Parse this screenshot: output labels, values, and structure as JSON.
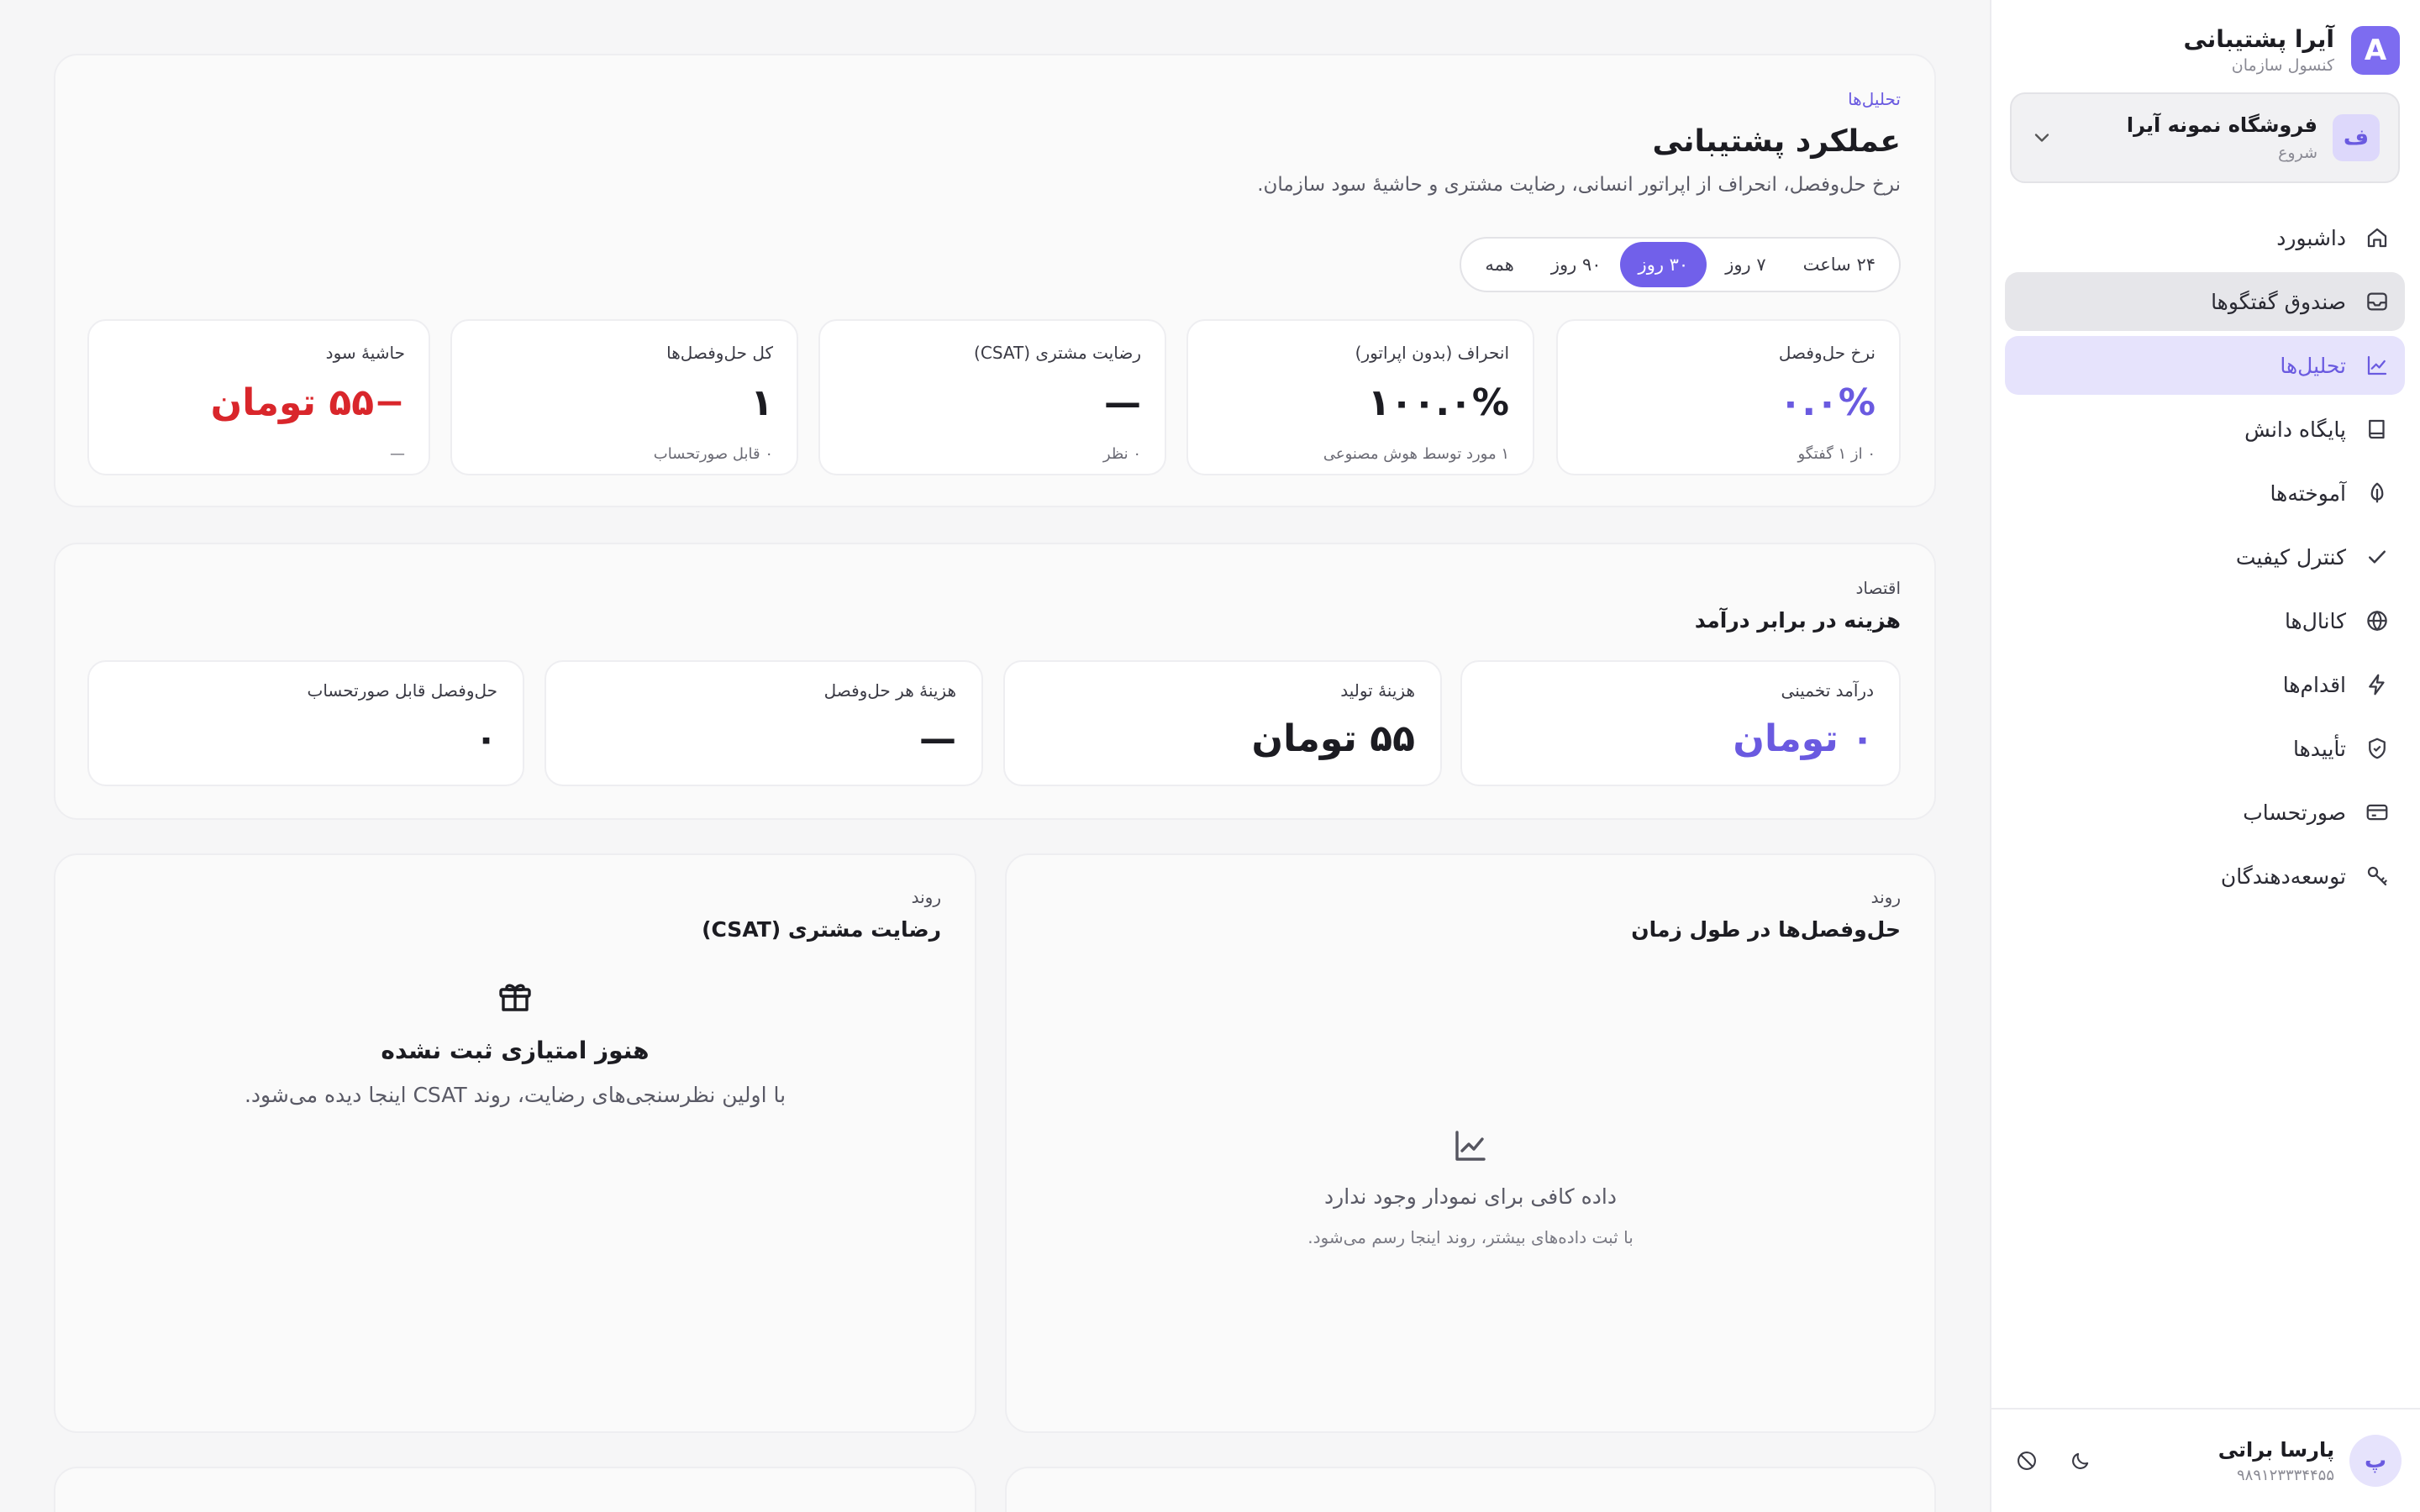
{
  "sidebar": {
    "brand": {
      "logo_letter": "A",
      "title": "آیرا پشتیبانی",
      "subtitle": "کنسول سازمان"
    },
    "org": {
      "avatar_letter": "ف",
      "name": "فروشگاه نمونه آیرا",
      "plan": "شروع"
    },
    "nav": [
      {
        "label": "داشبورد",
        "icon": "home-icon"
      },
      {
        "label": "صندوق گفتگوها",
        "icon": "inbox-icon"
      },
      {
        "label": "تحلیل‌ها",
        "icon": "chart-icon"
      },
      {
        "label": "پایگاه دانش",
        "icon": "book-icon"
      },
      {
        "label": "آموخته‌ها",
        "icon": "leaf-icon"
      },
      {
        "label": "کنترل کیفیت",
        "icon": "check-icon"
      },
      {
        "label": "کانال‌ها",
        "icon": "globe-icon"
      },
      {
        "label": "اقدام‌ها",
        "icon": "bolt-icon"
      },
      {
        "label": "تأییدها",
        "icon": "shield-icon"
      },
      {
        "label": "صورتحساب",
        "icon": "card-icon"
      },
      {
        "label": "توسعه‌دهندگان",
        "icon": "key-icon"
      }
    ],
    "active_index": 2,
    "user": {
      "avatar_letter": "پ",
      "name": "پارسا براتی",
      "phone": "۹۸۹۱۲۳۳۳۴۴۵۵"
    }
  },
  "performance": {
    "eyebrow": "تحلیل‌ها",
    "title": "عملکرد پشتیبانی",
    "description": "نرخ حل‌وفصل، انحراف از اپراتور انسانی، رضایت مشتری و حاشیهٔ سود سازمان.",
    "ranges": [
      "۲۴ ساعت",
      "۷ روز",
      "۳۰ روز",
      "۹۰ روز",
      "همه"
    ],
    "selected_range": "۳۰ روز",
    "kpis": [
      {
        "label": "نرخ حل‌وفصل",
        "value": "۰.۰%",
        "sub": "۰ از ۱ گفتگو"
      },
      {
        "label": "انحراف (بدون اپراتور)",
        "value": "۱۰۰.۰%",
        "sub": "۱ مورد توسط هوش مصنوعی"
      },
      {
        "label": "رضایت مشتری (CSAT)",
        "value": "—",
        "sub": "۰ نظر"
      },
      {
        "label": "کل حل‌وفصل‌ها",
        "value": "۱",
        "sub": "۰ قابل صورتحساب"
      },
      {
        "label": "حاشیهٔ سود",
        "value": "−۵۵ تومان",
        "sub": "—"
      }
    ]
  },
  "economics": {
    "eyebrow": "اقتصاد",
    "title": "هزینه در برابر درآمد",
    "kpis": [
      {
        "label": "درآمد تخمینی",
        "value": "۰ تومان"
      },
      {
        "label": "هزینهٔ تولید",
        "value": "۵۵ تومان"
      },
      {
        "label": "هزینهٔ هر حل‌وفصل",
        "value": "—"
      },
      {
        "label": "حل‌وفصل قابل صورتحساب",
        "value": "۰"
      }
    ]
  },
  "trend_resolutions": {
    "eyebrow": "روند",
    "title": "حل‌وفصل‌ها در طول زمان",
    "empty_title": "داده کافی برای نمودار وجود ندارد",
    "empty_text": "با ثبت داده‌های بیشتر، روند اینجا رسم می‌شود."
  },
  "trend_csat": {
    "eyebrow": "روند",
    "title": "رضایت مشتری (CSAT)",
    "empty_title": "هنوز امتیازی ثبت نشده",
    "empty_text": "با اولین نظرسنجی‌های رضایت، روند CSAT اینجا دیده می‌شود."
  },
  "colors": {
    "accent": "#7160ea",
    "negative": "#d9262b"
  }
}
